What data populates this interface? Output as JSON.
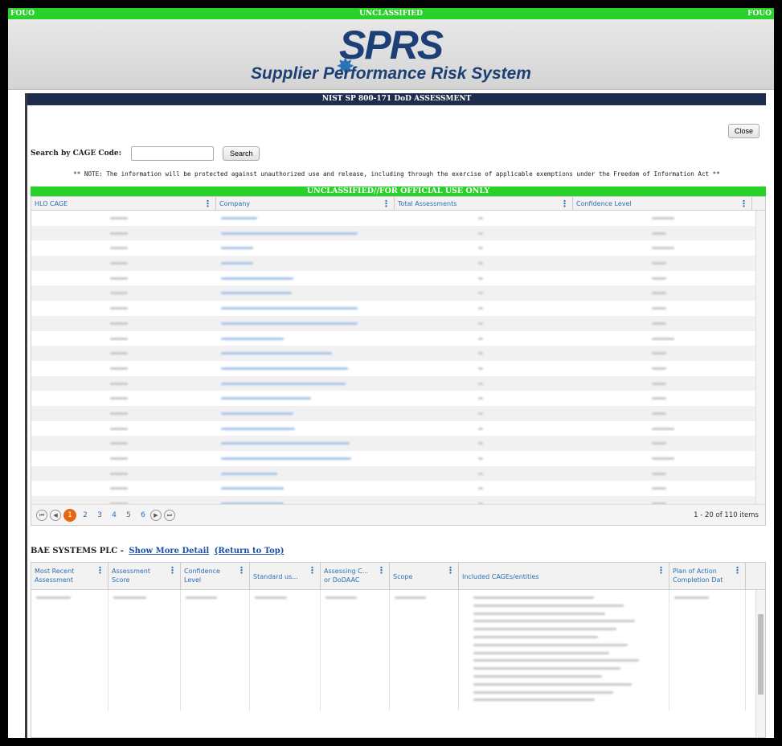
{
  "banner": {
    "left": "FOUO",
    "center": "UNCLASSIFIED",
    "right": "FOUO"
  },
  "header": {
    "logo": "SPRS",
    "subtitle": "Supplier Performance Risk System"
  },
  "panel": {
    "title": "NIST SP 800-171 DoD ASSESSMENT",
    "close_label": "Close",
    "search_label": "Search by CAGE Code:",
    "search_button": "Search",
    "note": "** NOTE: The information will be protected against unauthorized use and release, including through the exercise of applicable exemptions under the Freedom of Information Act **",
    "marking": "UNCLASSIFIED//FOR OFFICIAL USE ONLY"
  },
  "grid": {
    "columns": [
      "HLO CAGE",
      "Company",
      "Total Assessments",
      "Confidence Level"
    ],
    "pager": {
      "pages": [
        "1",
        "2",
        "3",
        "4",
        "5",
        "6"
      ],
      "active": "1",
      "info": "1 - 20 of 110 items"
    }
  },
  "detail": {
    "company": "BAE SYSTEMS PLC",
    "separator": "-",
    "show_more": "Show More Detail",
    "return_top": "(Return to Top)",
    "columns": [
      {
        "l1": "Most Recent",
        "l2": "Assessment"
      },
      {
        "l1": "Assessment",
        "l2": "Score"
      },
      {
        "l1": "Confidence",
        "l2": "Level"
      },
      {
        "l1": "Standard us...",
        "l2": ""
      },
      {
        "l1": "Assessing C...",
        "l2": "or DoDAAC"
      },
      {
        "l1": "Scope",
        "l2": ""
      },
      {
        "l1": "Included CAGEs/entities",
        "l2": ""
      },
      {
        "l1": "Plan of Action",
        "l2": "Completion Dat"
      }
    ]
  },
  "icons": {
    "first": "first-page-icon",
    "prev": "prev-page-icon",
    "next": "next-page-icon",
    "last": "last-page-icon",
    "kebab": "column-menu-icon"
  }
}
